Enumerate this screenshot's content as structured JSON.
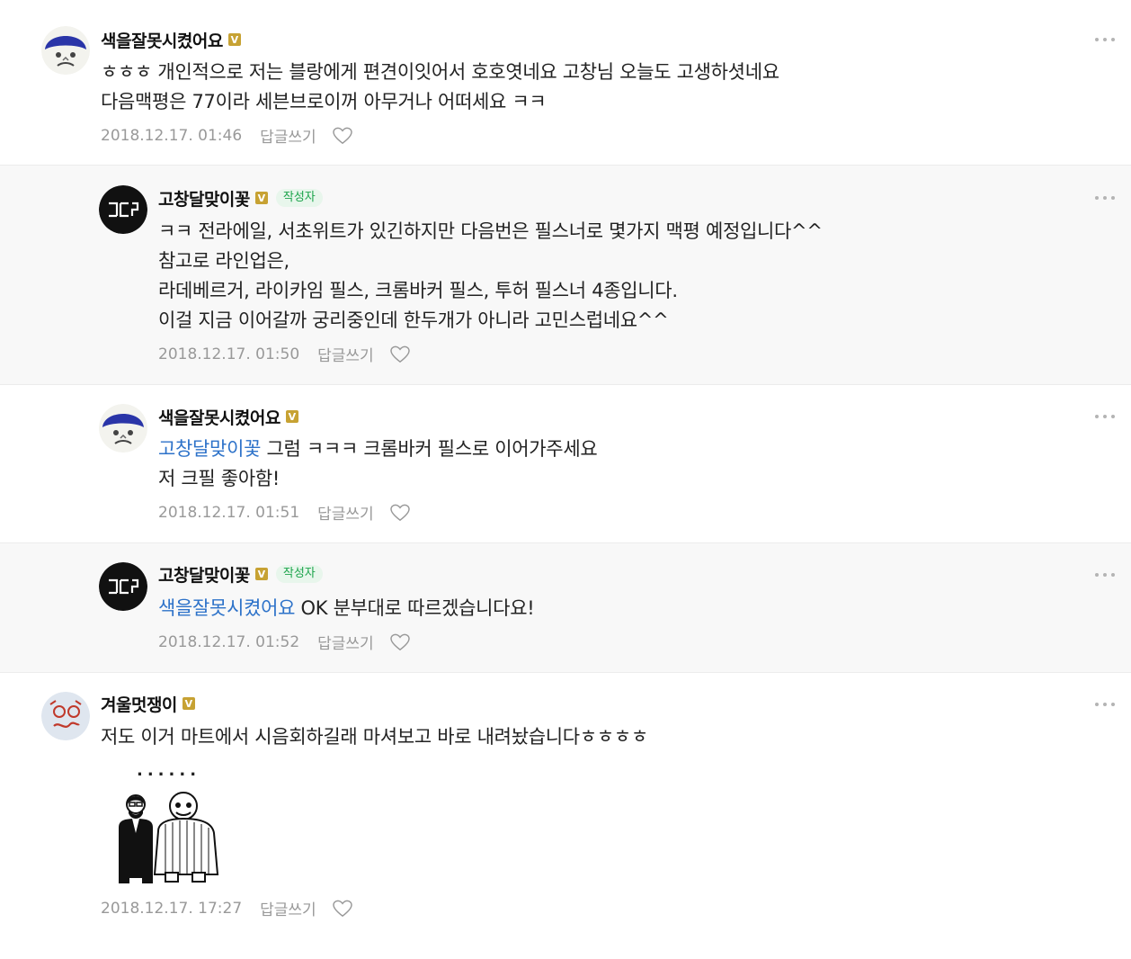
{
  "comments": [
    {
      "name": "색을잘못시켰어요",
      "badge": "V",
      "lines": [
        "ㅎㅎㅎ 개인적으로 저는 블랑에게 편견이잇어서 호호엿네요 고창님 오늘도 고생하셧네요",
        "다음맥평은 77이라 세븐브로이꺼 아무거나 어떠세요 ㅋㅋ"
      ],
      "date": "2018.12.17. 01:46",
      "reply_label": "답글쓰기"
    },
    {
      "name": "고창달맞이꽃",
      "badge": "V",
      "author_tag": "작성자",
      "lines": [
        "ㅋㅋ 전라에일, 서초위트가 있긴하지만 다음번은 필스너로 몇가지 맥평 예정입니다^^",
        "참고로 라인업은,",
        "라데베르거, 라이카임 필스, 크롬바커 필스, 투허 필스너 4종입니다.",
        "이걸 지금 이어갈까 궁리중인데 한두개가 아니라 고민스럽네요^^"
      ],
      "date": "2018.12.17. 01:50",
      "reply_label": "답글쓰기"
    },
    {
      "name": "색을잘못시켰어요",
      "badge": "V",
      "mention": "고창달맞이꽃",
      "lines": [
        " 그럼 ㅋㅋㅋ 크롬바커 필스로 이어가주세요",
        "저 크필 좋아함!"
      ],
      "date": "2018.12.17. 01:51",
      "reply_label": "답글쓰기"
    },
    {
      "name": "고창달맞이꽃",
      "badge": "V",
      "author_tag": "작성자",
      "mention": "색을잘못시켰어요",
      "lines": [
        " OK 분부대로 따르겠습니다요!"
      ],
      "date": "2018.12.17. 01:52",
      "reply_label": "답글쓰기"
    },
    {
      "name": "겨울멋쟁이",
      "badge": "V",
      "lines": [
        "저도 이거 마트에서 시음회하길래 마셔보고 바로 내려놨습니다ㅎㅎㅎㅎ"
      ],
      "sticker_caption": "......",
      "date": "2018.12.17. 17:27",
      "reply_label": "답글쓰기"
    }
  ],
  "colors": {
    "mention": "#2d72c9",
    "author_tag_text": "#1aa34a",
    "badge": "#c7a233",
    "meta": "#999999"
  },
  "icons": {
    "more": "more-dots-icon",
    "like": "heart-outline-icon",
    "badge": "verified-badge-icon"
  }
}
